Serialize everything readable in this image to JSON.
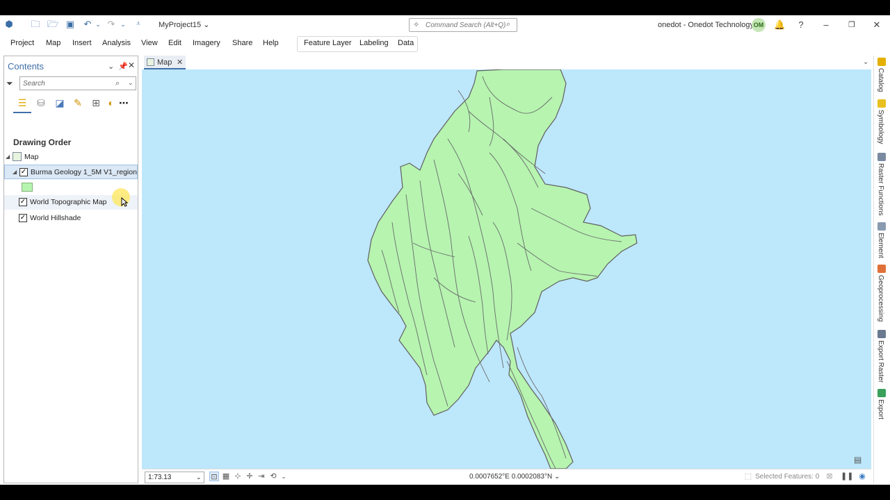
{
  "titlebar": {
    "project_name": "MyProject15",
    "command_search_placeholder": "Command Search (Alt+Q)",
    "user_label": "onedot - Onedot Technology",
    "avatar_initials": "OM",
    "help": "?"
  },
  "ribbon": {
    "tabs": [
      "Project",
      "Map",
      "Insert",
      "Analysis",
      "View",
      "Edit",
      "Imagery",
      "Share",
      "Help"
    ],
    "context_tabs": [
      "Feature Layer",
      "Labeling",
      "Data"
    ]
  },
  "contents": {
    "title": "Contents",
    "search_placeholder": "Search",
    "section": "Drawing Order",
    "map_node": "Map",
    "layers": [
      {
        "name": "Burma Geology 1_5M V1_region",
        "checked": true
      },
      {
        "name": "World Topographic Map",
        "checked": true
      },
      {
        "name": "World Hillshade",
        "checked": true
      }
    ],
    "symbol_color": "#b6f4b0"
  },
  "map": {
    "tab_label": "Map",
    "water_color": "#bde7fb",
    "land_color": "#b6f4b0"
  },
  "statusbar": {
    "scale": "1:73.13",
    "coordinates": "0.0007652°E 0.0002083°N",
    "selected_features": "Selected Features: 0"
  },
  "right_dock": {
    "tabs": [
      {
        "label": "Catalog",
        "icon_color": "#e3b000"
      },
      {
        "label": "Symbology",
        "icon_color": "#e8c020"
      },
      {
        "label": "Raster Functions",
        "icon_color": "#7a8aa0"
      },
      {
        "label": "Element",
        "icon_color": "#8a9bb0"
      },
      {
        "label": "Geoprocessing",
        "icon_color": "#e0703a"
      },
      {
        "label": "Export Raster",
        "icon_color": "#6a7a90"
      },
      {
        "label": "Export",
        "icon_color": "#3aa05a"
      }
    ]
  }
}
